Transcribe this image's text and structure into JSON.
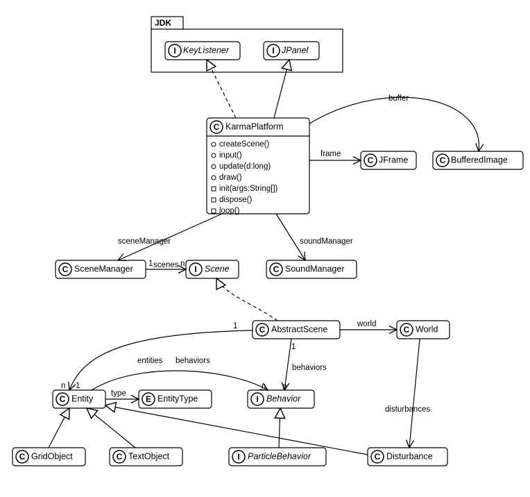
{
  "package": {
    "name": "JDK"
  },
  "nodes": {
    "keylistener": {
      "badge": "I",
      "name": "KeyListener",
      "italic": true
    },
    "jpanel": {
      "badge": "I",
      "name": "JPanel",
      "italic": true
    },
    "karma": {
      "badge": "C",
      "name": "KarmaPlatform"
    },
    "jframe": {
      "badge": "C",
      "name": "JFrame"
    },
    "bufimg": {
      "badge": "C",
      "name": "BufferedImage"
    },
    "scenemgr": {
      "badge": "C",
      "name": "SceneManager"
    },
    "scene": {
      "badge": "I",
      "name": "Scene",
      "italic": true
    },
    "soundmgr": {
      "badge": "C",
      "name": "SoundManager"
    },
    "abscene": {
      "badge": "C",
      "name": "AbstractScene"
    },
    "world": {
      "badge": "C",
      "name": "World"
    },
    "entity": {
      "badge": "C",
      "name": "Entity"
    },
    "entitytype": {
      "badge": "E",
      "name": "EntityType"
    },
    "behavior": {
      "badge": "I",
      "name": "Behavior",
      "italic": true
    },
    "gridobj": {
      "badge": "C",
      "name": "GridObject"
    },
    "textobj": {
      "badge": "C",
      "name": "TextObject"
    },
    "particlebeh": {
      "badge": "I",
      "name": "ParticleBehavior",
      "italic": true
    },
    "disturbance": {
      "badge": "C",
      "name": "Disturbance"
    }
  },
  "methods": {
    "karma": [
      {
        "vis": "circ",
        "text": "createScene()"
      },
      {
        "vis": "circ",
        "text": "input()"
      },
      {
        "vis": "circ",
        "text": "update(d:long)"
      },
      {
        "vis": "circ",
        "text": "draw()"
      },
      {
        "vis": "sq",
        "text": "init(args:String[])"
      },
      {
        "vis": "sq",
        "text": "dispose()"
      },
      {
        "vis": "sq",
        "text": "loop()"
      }
    ]
  },
  "edge_labels": {
    "buffer": "buffer",
    "frame": "frame",
    "sceneManager": "sceneManager",
    "soundManager": "soundManager",
    "scenes": "scenes",
    "world": "world",
    "behaviors": "behaviors",
    "entities": "entities",
    "type": "type",
    "disturbances": "disturbances"
  },
  "mult": {
    "one": "1",
    "n": "n"
  }
}
